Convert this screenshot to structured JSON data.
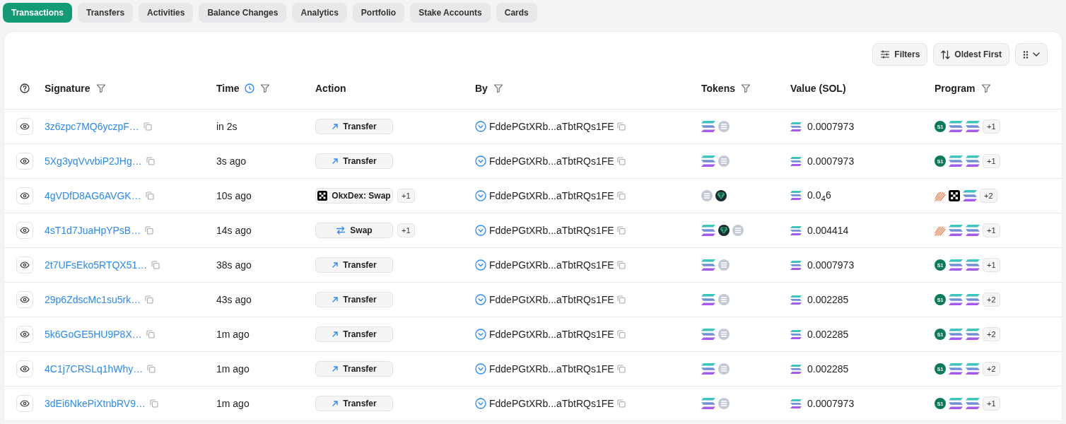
{
  "tabs": [
    {
      "label": "Transactions",
      "selected": true
    },
    {
      "label": "Transfers",
      "selected": false
    },
    {
      "label": "Activities",
      "selected": false
    },
    {
      "label": "Balance Changes",
      "selected": false
    },
    {
      "label": "Analytics",
      "selected": false
    },
    {
      "label": "Portfolio",
      "selected": false
    },
    {
      "label": "Stake Accounts",
      "selected": false
    },
    {
      "label": "Cards",
      "selected": false
    }
  ],
  "toolbar": [
    {
      "kind": "filters",
      "label": "Filters"
    },
    {
      "kind": "sort",
      "label": "Oldest First"
    },
    {
      "kind": "view"
    }
  ],
  "table": {
    "columns": [
      {
        "kind": "help"
      },
      {
        "label": "Signature",
        "filter": true
      },
      {
        "label": "Time",
        "clock": true,
        "filter": true
      },
      {
        "label": "Action",
        "filter": false
      },
      {
        "label": "By",
        "filter": true
      },
      {
        "label": "Tokens",
        "filter": true
      },
      {
        "label": "Value (SOL)",
        "filter": false
      },
      {
        "label": "Program",
        "filter": true
      }
    ],
    "rows": [
      {
        "signature": "3z6zpc7MQ6yczpF…",
        "time": "in 2s",
        "action": {
          "kind": "transfer",
          "label": "Transfer"
        },
        "by": "FddePGtXRb...aTbtRQs1FE",
        "tokens": [
          {
            "kind": "sol"
          },
          {
            "kind": "gray"
          }
        ],
        "value": "0.0007973",
        "programs": [
          {
            "kind": "s1",
            "text": "S1"
          },
          {
            "kind": "sol"
          },
          {
            "kind": "sol"
          }
        ],
        "more": "+1"
      },
      {
        "signature": "5Xg3yqVvvbiP2JHg…",
        "time": "3s ago",
        "action": {
          "kind": "transfer",
          "label": "Transfer"
        },
        "by": "FddePGtXRb...aTbtRQs1FE",
        "tokens": [
          {
            "kind": "sol"
          },
          {
            "kind": "gray"
          }
        ],
        "value": "0.0007973",
        "programs": [
          {
            "kind": "s1",
            "text": "S1"
          },
          {
            "kind": "sol"
          },
          {
            "kind": "sol"
          }
        ],
        "more": "+1"
      },
      {
        "signature": "4gVDfD8AG6AVGK…",
        "time": "10s ago",
        "action": {
          "kind": "okx",
          "label": "OkxDex: Swap",
          "extra": "+1"
        },
        "by": "FddePGtXRb...aTbtRQs1FE",
        "tokens": [
          {
            "kind": "gray"
          },
          {
            "kind": "usdt"
          }
        ],
        "value": "0.0$_{4}$6",
        "programs": [
          {
            "kind": "stripes"
          },
          {
            "kind": "okx"
          },
          {
            "kind": "sol"
          }
        ],
        "more": "+2"
      },
      {
        "signature": "4sT1d7JuaHpYPsB…",
        "time": "14s ago",
        "action": {
          "kind": "swap",
          "label": "Swap",
          "extra": "+1"
        },
        "by": "FddePGtXRb...aTbtRQs1FE",
        "tokens": [
          {
            "kind": "sol"
          },
          {
            "kind": "usdt"
          },
          {
            "kind": "gray"
          }
        ],
        "value": "0.004414",
        "programs": [
          {
            "kind": "stripes"
          },
          {
            "kind": "sol"
          },
          {
            "kind": "sol"
          }
        ],
        "more": "+1"
      },
      {
        "signature": "2t7UFsEko5RTQX51…",
        "time": "38s ago",
        "action": {
          "kind": "transfer",
          "label": "Transfer"
        },
        "by": "FddePGtXRb...aTbtRQs1FE",
        "tokens": [
          {
            "kind": "sol"
          },
          {
            "kind": "gray"
          }
        ],
        "value": "0.0007973",
        "programs": [
          {
            "kind": "s1",
            "text": "S1"
          },
          {
            "kind": "sol"
          },
          {
            "kind": "sol"
          }
        ],
        "more": "+1"
      },
      {
        "signature": "29p6ZdscMc1su5rk…",
        "time": "43s ago",
        "action": {
          "kind": "transfer",
          "label": "Transfer"
        },
        "by": "FddePGtXRb...aTbtRQs1FE",
        "tokens": [
          {
            "kind": "sol"
          },
          {
            "kind": "gray"
          }
        ],
        "value": "0.002285",
        "programs": [
          {
            "kind": "s1",
            "text": "S1"
          },
          {
            "kind": "sol"
          },
          {
            "kind": "sol"
          }
        ],
        "more": "+2"
      },
      {
        "signature": "5k6GoGE5HU9P8X…",
        "time": "1m ago",
        "action": {
          "kind": "transfer",
          "label": "Transfer"
        },
        "by": "FddePGtXRb...aTbtRQs1FE",
        "tokens": [
          {
            "kind": "sol"
          },
          {
            "kind": "gray"
          }
        ],
        "value": "0.002285",
        "programs": [
          {
            "kind": "s1",
            "text": "S1"
          },
          {
            "kind": "sol"
          },
          {
            "kind": "sol"
          }
        ],
        "more": "+2"
      },
      {
        "signature": "4C1j7CRSLq1hWhy…",
        "time": "1m ago",
        "action": {
          "kind": "transfer",
          "label": "Transfer"
        },
        "by": "FddePGtXRb...aTbtRQs1FE",
        "tokens": [
          {
            "kind": "sol"
          },
          {
            "kind": "gray"
          }
        ],
        "value": "0.002285",
        "programs": [
          {
            "kind": "s1",
            "text": "S1"
          },
          {
            "kind": "sol"
          },
          {
            "kind": "sol"
          }
        ],
        "more": "+2"
      },
      {
        "signature": "3dEi6NkePiXtnbRV9…",
        "time": "1m ago",
        "action": {
          "kind": "transfer",
          "label": "Transfer"
        },
        "by": "FddePGtXRb...aTbtRQs1FE",
        "tokens": [
          {
            "kind": "sol"
          },
          {
            "kind": "gray"
          }
        ],
        "value": "0.0007973",
        "programs": [
          {
            "kind": "s1",
            "text": "S1"
          },
          {
            "kind": "sol"
          },
          {
            "kind": "sol"
          }
        ],
        "more": "+1"
      }
    ]
  }
}
